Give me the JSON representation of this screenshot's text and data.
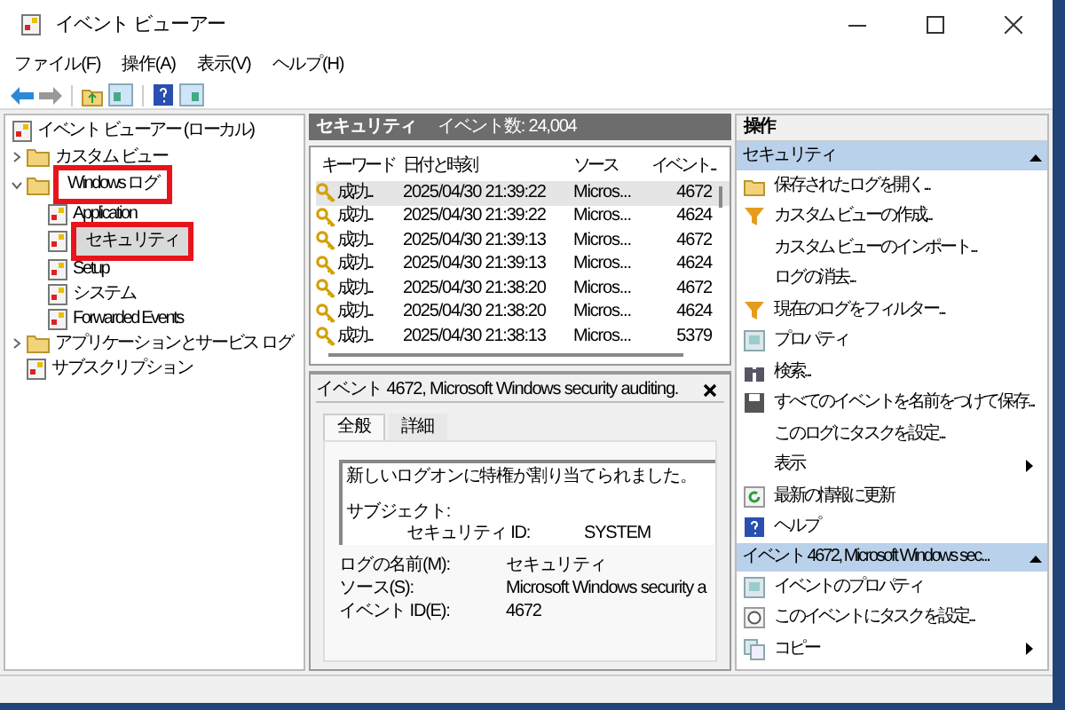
{
  "window": {
    "title": "イベント ビューアー"
  },
  "menu": [
    "ファイル(F)",
    "操作(A)",
    "表示(V)",
    "ヘルプ(H)"
  ],
  "tree": [
    {
      "label": "イベント ビューアー (ローカル)",
      "selected": false,
      "highlighted": false,
      "children": [
        {
          "label": "カスタム ビュー",
          "expanded": false,
          "selected": false,
          "highlighted": false
        },
        {
          "label": "Windows ログ",
          "expanded": true,
          "selected": false,
          "highlighted": true,
          "children": [
            {
              "label": "Application",
              "selected": false,
              "highlighted": false
            },
            {
              "label": "セキュリティ",
              "selected": true,
              "highlighted": true
            },
            {
              "label": "Setup",
              "selected": false,
              "highlighted": false
            },
            {
              "label": "システム",
              "selected": false,
              "highlighted": false
            },
            {
              "label": "Forwarded Events",
              "selected": false,
              "highlighted": false
            }
          ]
        },
        {
          "label": "アプリケーションとサービス ログ",
          "expanded": false,
          "selected": false,
          "highlighted": false
        },
        {
          "label": "サブスクリプション",
          "selected": false,
          "highlighted": false
        }
      ]
    }
  ],
  "log_header": {
    "title": "セキュリティ",
    "count": "イベント数: 24,004"
  },
  "table": {
    "columns": [
      "キーワード",
      "日付と時刻",
      "ソース",
      "イベント..."
    ],
    "rows": [
      {
        "selected": true,
        "cells": [
          "成功...",
          "2025/04/30 21:39:22",
          "Micros...",
          "4672"
        ]
      },
      {
        "selected": false,
        "cells": [
          "成功...",
          "2025/04/30 21:39:22",
          "Micros...",
          "4624"
        ]
      },
      {
        "selected": false,
        "cells": [
          "成功...",
          "2025/04/30 21:39:13",
          "Micros...",
          "4672"
        ]
      },
      {
        "selected": false,
        "cells": [
          "成功...",
          "2025/04/30 21:39:13",
          "Micros...",
          "4624"
        ]
      },
      {
        "selected": false,
        "cells": [
          "成功...",
          "2025/04/30 21:38:20",
          "Micros...",
          "4672"
        ]
      },
      {
        "selected": false,
        "cells": [
          "成功...",
          "2025/04/30 21:38:20",
          "Micros...",
          "4624"
        ]
      },
      {
        "selected": false,
        "cells": [
          "成功...",
          "2025/04/30 21:38:13",
          "Micros...",
          "5379"
        ]
      }
    ]
  },
  "detail": {
    "title": "イベント 4672, Microsoft Windows security auditing.",
    "tabs": [
      {
        "label": "全般",
        "selected": true
      },
      {
        "label": "詳細",
        "selected": false
      }
    ],
    "message": "新しいログオンに特権が割り当てられました。",
    "subject_label": "サブジェクト:",
    "security_id_label": "セキュリティ ID:",
    "security_id_value": "SYSTEM",
    "fields": [
      {
        "label": "ログの名前(M):",
        "value": "セキュリティ"
      },
      {
        "label": "ソース(S):",
        "value": "Microsoft Windows security a"
      },
      {
        "label": "イベント ID(E):",
        "value": "4672"
      }
    ]
  },
  "actions": {
    "title": "操作",
    "sections": [
      {
        "title": "セキュリティ",
        "expanded": true,
        "items": [
          {
            "label": "保存されたログを開く...",
            "kind": "action"
          },
          {
            "label": "カスタム ビューの作成...",
            "kind": "action"
          },
          {
            "label": "カスタム ビューのインポート...",
            "kind": "action"
          },
          {
            "label": "ログの消去...",
            "kind": "action"
          },
          {
            "label": "現在のログをフィルター...",
            "kind": "action"
          },
          {
            "label": "プロパティ",
            "kind": "action"
          },
          {
            "label": "検索...",
            "kind": "action"
          },
          {
            "label": "すべてのイベントを名前をつけて保存...",
            "kind": "action"
          },
          {
            "label": "このログにタスクを設定...",
            "kind": "action"
          },
          {
            "label": "表示",
            "kind": "submenu"
          },
          {
            "label": "最新の情報に更新",
            "kind": "action"
          },
          {
            "label": "ヘルプ",
            "kind": "action"
          }
        ]
      },
      {
        "title": "イベント 4672, Microsoft Windows sec...",
        "expanded": true,
        "items": [
          {
            "label": "イベントのプロパティ",
            "kind": "action"
          },
          {
            "label": "このイベントにタスクを設定...",
            "kind": "action"
          },
          {
            "label": "コピー",
            "kind": "submenu"
          }
        ]
      }
    ]
  }
}
